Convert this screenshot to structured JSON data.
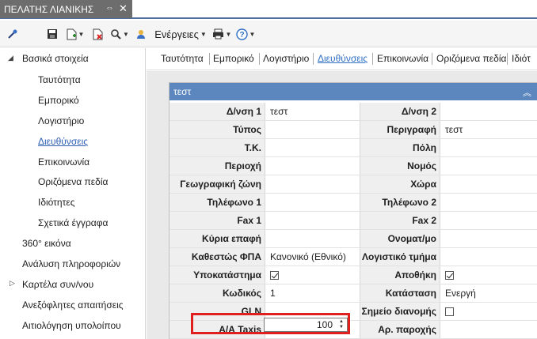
{
  "window": {
    "tab_title": "ΠΕΛΑΤΗΣ ΛΙΑΝΙΚΗΣ",
    "pin_glyph": "⇔",
    "close_glyph": "✕"
  },
  "toolbar": {
    "actions_label": "Ενέργειες"
  },
  "nav": {
    "group_title": "Βασικά στοιχεία",
    "sub_items": [
      "Ταυτότητα",
      "Εμπορικό",
      "Λογιστήριο",
      "Διευθύνσεις",
      "Επικοινωνία",
      "Οριζόμενα πεδία",
      "Ιδιότητες",
      "Σχετικά έγγραφα"
    ],
    "active_sub": "Διευθύνσεις",
    "top_items": [
      "360° εικόνα",
      "Ανάλυση πληροφοριών",
      "Καρτέλα συν/νου",
      "Ανεξόφλητες απαιτήσεις",
      "Αιτιολόγηση υπολοίπου"
    ]
  },
  "section_tabs": [
    "Ταυτότητα",
    "Εμπορικό",
    "Λογιστήριο",
    "Διευθύνσεις",
    "Επικοινωνία",
    "Οριζόμενα πεδία",
    "Ιδιότ"
  ],
  "group": {
    "title": "τεστ",
    "rows": [
      {
        "left_label": "Δ/νση 1",
        "left_value": "τεστ",
        "right_label": "Δ/νση 2",
        "right_value": ""
      },
      {
        "left_label": "Τύπος",
        "left_value": "",
        "right_label": "Περιγραφή",
        "right_value": "τεστ"
      },
      {
        "left_label": "Τ.Κ.",
        "left_value": "",
        "right_label": "Πόλη",
        "right_value": ""
      },
      {
        "left_label": "Περιοχή",
        "left_value": "",
        "right_label": "Νομός",
        "right_value": ""
      },
      {
        "left_label": "Γεωγραφική ζώνη",
        "left_value": "",
        "right_label": "Χώρα",
        "right_value": ""
      },
      {
        "left_label": "Τηλέφωνο 1",
        "left_value": "",
        "right_label": "Τηλέφωνο 2",
        "right_value": ""
      },
      {
        "left_label": "Fax 1",
        "left_value": "",
        "right_label": "Fax 2",
        "right_value": ""
      },
      {
        "left_label": "Κύρια επαφή",
        "left_value": "",
        "right_label": "Ονοματ/μο",
        "right_value": ""
      },
      {
        "left_label": "Καθεστώς ΦΠΑ",
        "left_value": "Κανονικό (Εθνικό)",
        "right_label": "Λογιστικό τμήμα",
        "right_value": ""
      },
      {
        "left_label": "Υποκατάστημα",
        "left_value": "",
        "right_label": "Αποθήκη",
        "right_value": ""
      },
      {
        "left_label": "Κωδικός",
        "left_value": "1",
        "right_label": "Κατάσταση",
        "right_value": "Ενεργή"
      },
      {
        "left_label": "GLN",
        "left_value": "",
        "right_label": "Σημείο διανομής",
        "right_value": ""
      },
      {
        "left_label": "Α/Α Taxis",
        "left_value": "100",
        "right_label": "Αρ. παροχής",
        "right_value": ""
      }
    ],
    "checkboxes": {
      "branch_checked": true,
      "warehouse_checked": true,
      "distribution_point_checked": false
    }
  }
}
